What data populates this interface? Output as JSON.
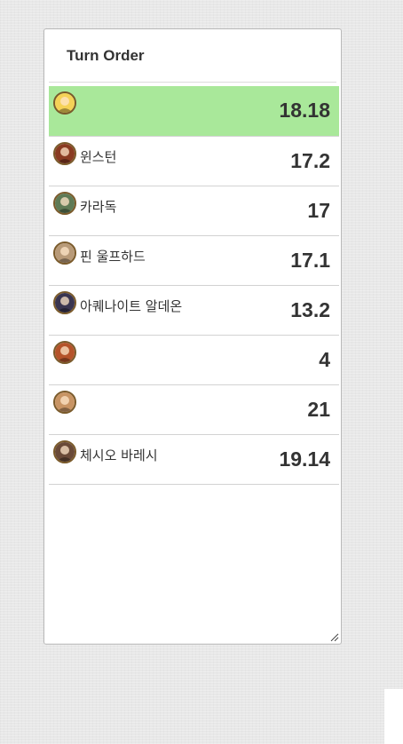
{
  "panel": {
    "title": "Turn Order"
  },
  "turn_order": [
    {
      "name": "",
      "value": "18.18",
      "active": true,
      "avatar_icon": "portrait-icon",
      "avatar_color": "#f5d257"
    },
    {
      "name": "윈스턴",
      "value": "17.2",
      "active": false,
      "avatar_icon": "portrait-icon",
      "avatar_color": "#8a3b22"
    },
    {
      "name": "카라독",
      "value": "17",
      "active": false,
      "avatar_icon": "portrait-icon",
      "avatar_color": "#5f7a55"
    },
    {
      "name": "핀 울프하드",
      "value": "17.1",
      "active": false,
      "avatar_icon": "portrait-icon",
      "avatar_color": "#b89a78"
    },
    {
      "name": "아퀘나이트 알데온",
      "value": "13.2",
      "active": false,
      "avatar_icon": "portrait-icon",
      "avatar_color": "#3a3550"
    },
    {
      "name": "",
      "value": "4",
      "active": false,
      "avatar_icon": "portrait-icon",
      "avatar_color": "#b5532a"
    },
    {
      "name": "",
      "value": "21",
      "active": false,
      "avatar_icon": "portrait-icon",
      "avatar_color": "#c89464"
    },
    {
      "name": "체시오 바레시",
      "value": "19.14",
      "active": false,
      "avatar_icon": "portrait-icon",
      "avatar_color": "#6a4a38"
    }
  ],
  "colors": {
    "active_row": "#a9e89a",
    "text": "#333333"
  }
}
